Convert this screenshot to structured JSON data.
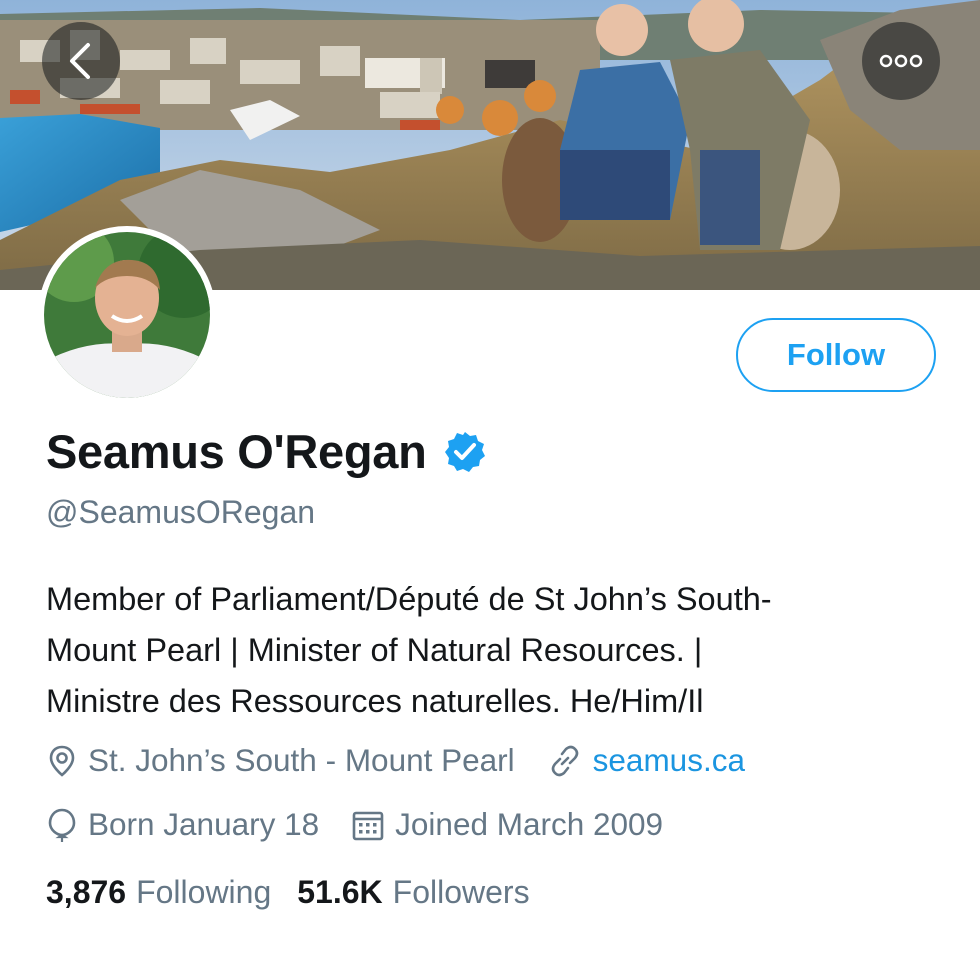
{
  "banner": {
    "background_icon": "photo-banner"
  },
  "nav": {
    "back_icon": "chevron-left-icon",
    "more_icon": "more-horizontal-icon"
  },
  "profile": {
    "name": "Seamus O'Regan",
    "handle": "@SeamusORegan",
    "verified": true,
    "bio_lines": [
      "Member of Parliament/Député de St John’s South-",
      "Mount Pearl | Minister of Natural Resources. |",
      "Ministre des Ressources naturelles. He/Him/Il"
    ],
    "location": "St. John’s South - Mount Pearl",
    "website": "seamus.ca",
    "birthday": "Born January 18",
    "joined": "Joined March 2009"
  },
  "stats": {
    "following_count": "3,876",
    "following_label": "Following",
    "followers_count": "51.6K",
    "followers_label": "Followers"
  },
  "actions": {
    "follow_label": "Follow"
  },
  "colors": {
    "accent": "#1da1f2",
    "link": "#1b95e0",
    "muted": "#657786",
    "text": "#14171a"
  }
}
